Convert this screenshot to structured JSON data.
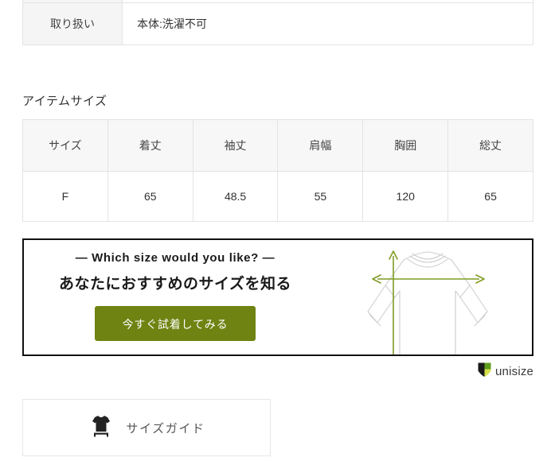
{
  "spec_table": {
    "rows": [
      {
        "label": "",
        "value": ""
      },
      {
        "label": "取り扱い",
        "value": "本体:洗濯不可"
      }
    ]
  },
  "item_size": {
    "section_title": "アイテムサイズ",
    "headers": [
      "サイズ",
      "着丈",
      "袖丈",
      "肩幅",
      "胸囲",
      "総丈"
    ],
    "rows": [
      [
        "F",
        "65",
        "48.5",
        "55",
        "120",
        "65"
      ]
    ]
  },
  "promo": {
    "kicker": "— Which size would you like? —",
    "headline": "あなたにおすすめのサイズを知る",
    "cta_label": "今すぐ試着してみる",
    "cta_color": "#6f8312",
    "border_color": "#111111",
    "figure_icon": "tshirt-measurement-diagram",
    "arrow_color": "#7f9b23",
    "garment_outline_color": "#cccccc"
  },
  "unisize": {
    "wordmark": "unisize",
    "logo_icon": "unisize-shield-logo",
    "logo_dark": "#1a1a1a",
    "logo_green": "#5f9d1e",
    "logo_light": "#d7e04b"
  },
  "size_guide": {
    "label": "サイズガイド",
    "icon": "tshirt-ruler-icon",
    "icon_color": "#222222"
  }
}
